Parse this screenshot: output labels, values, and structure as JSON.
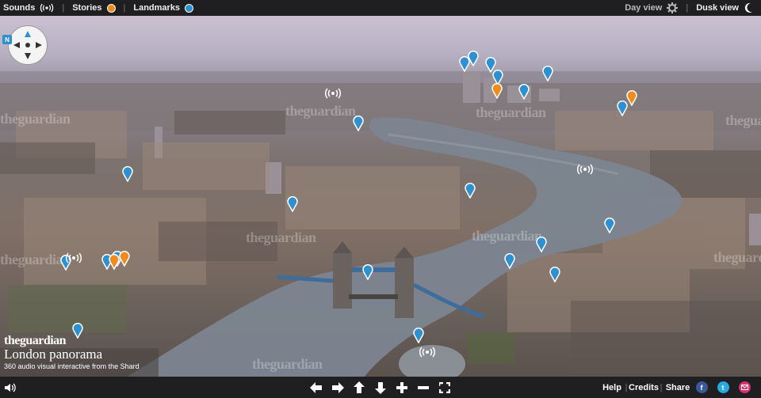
{
  "topbar": {
    "sounds_label": "Sounds",
    "stories_label": "Stories",
    "landmarks_label": "Landmarks",
    "day_view_label": "Day view",
    "dusk_view_label": "Dusk view"
  },
  "colors": {
    "story_pin": "#f08c1e",
    "landmark_pin": "#2e8fd1",
    "bar_bg": "#1f1f22"
  },
  "branding": {
    "logo": "theguardian",
    "title": "London panorama",
    "subtitle": "360 audio visual interactive from the Shard"
  },
  "watermark": "theguardian",
  "compass": {
    "badge": "N"
  },
  "bottombar": {
    "controls": [
      "arrow-left-icon",
      "arrow-right-icon",
      "arrow-up-icon",
      "arrow-down-icon",
      "zoom-in-icon",
      "zoom-out-icon",
      "fullscreen-icon"
    ],
    "help_label": "Help",
    "credits_label": "Credits",
    "share_label": "Share",
    "facebook_glyph": "f",
    "twitter_glyph": "t"
  }
}
